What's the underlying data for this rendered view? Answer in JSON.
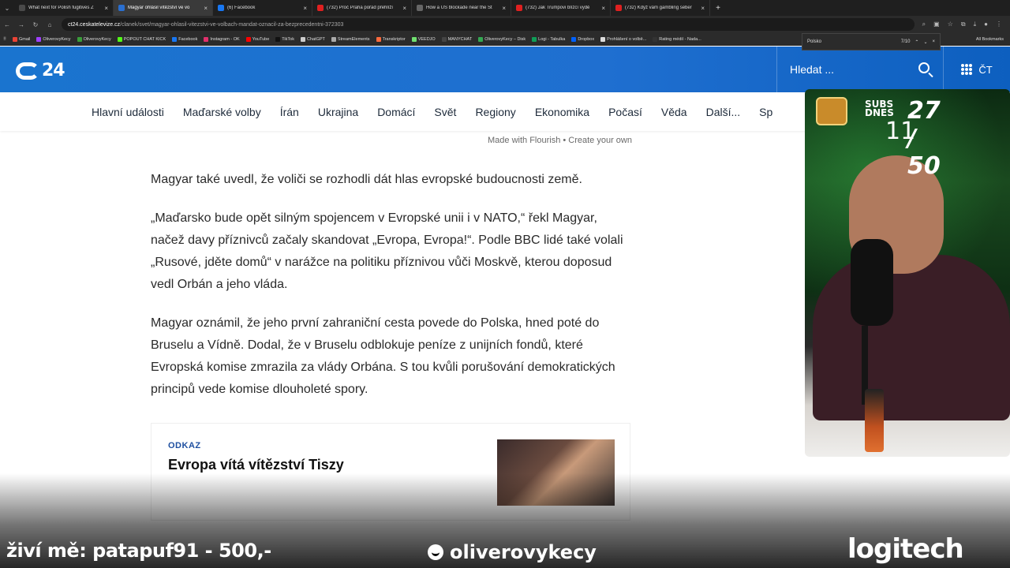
{
  "tabs": [
    {
      "label": "What next for Polish fugitives Z",
      "color": "#4a4a4a",
      "active": false
    },
    {
      "label": "Magyar ohlásil vítězství ve vo",
      "color": "#2a6fd0",
      "active": true
    },
    {
      "label": "(6) Facebook",
      "color": "#1877f2",
      "active": false
    },
    {
      "label": "(732) Proč Praha pořád přehlíží",
      "color": "#e02020",
      "active": false
    },
    {
      "label": "How a US blockade near the St",
      "color": "#666666",
      "active": false
    },
    {
      "label": "(732) Jak Trumpovi blízcí vydě",
      "color": "#e02020",
      "active": false
    },
    {
      "label": "(732) Když vám gambling seber",
      "color": "#e02020",
      "active": false
    }
  ],
  "address": {
    "domain": "ct24.ceskatelevize.cz",
    "path": "/clanek/svet/magyar-ohlasil-vitezstvi-ve-volbach-mandat-oznacil-za-bezprecedentni-372303"
  },
  "bookmarks": [
    {
      "label": "Gmail",
      "color": "#ea4335"
    },
    {
      "label": "OliverovyKecy",
      "color": "#a040ff"
    },
    {
      "label": "OliverovyKecy",
      "color": "#3a9d3a"
    },
    {
      "label": "POPOUT CHAT KICK",
      "color": "#53fc18"
    },
    {
      "label": "Facebook",
      "color": "#1877f2"
    },
    {
      "label": "Instagram - OK",
      "color": "#e1306c"
    },
    {
      "label": "YouTube",
      "color": "#ff0000"
    },
    {
      "label": "TikTok",
      "color": "#111111"
    },
    {
      "label": "ChatGPT",
      "color": "#cccccc"
    },
    {
      "label": "StreamElements",
      "color": "#aaaaaa"
    },
    {
      "label": "Transkriptor",
      "color": "#ff6a3d"
    },
    {
      "label": "VEEDJO",
      "color": "#70e070"
    },
    {
      "label": "MANYCHAT",
      "color": "#444444"
    },
    {
      "label": "OliverovyKecy – Disk",
      "color": "#34a853"
    },
    {
      "label": "Logi - Tabulka",
      "color": "#0f9d58"
    },
    {
      "label": "Dropbox",
      "color": "#0061ff"
    },
    {
      "label": "Prohlášení o volbě...",
      "color": "#dddddd"
    },
    {
      "label": "Rating médií - Nada...",
      "color": "#333333"
    }
  ],
  "all_bookmarks": "All Bookmarks",
  "find": {
    "query": "Polsko",
    "count": "7/10"
  },
  "site": {
    "logo_text": "24",
    "search_placeholder": "Hledat ...",
    "ct_label": "ČT"
  },
  "nav": [
    "Hlavní události",
    "Maďarské volby",
    "Írán",
    "Ukrajina",
    "Domácí",
    "Svět",
    "Regiony",
    "Ekonomika",
    "Počasí",
    "Věda",
    "Další...",
    "Sp"
  ],
  "flourish": "Made with Flourish • Create your own",
  "article": {
    "p1": "Magyar také uvedl, že voliči se rozhodli dát hlas evropské budoucnosti země.",
    "p2": "„Maďarsko bude opět silným spojencem v Evropské unii i v NATO,“ řekl Magyar, načež davy příznivců začaly skandovat „Evropa, Evropa!“. Podle BBC lidé také volali „Rusové, jděte domů“ v narážce na politiku příznivou vůči Moskvě, kterou doposud vedl Orbán a jeho vláda.",
    "p3": "Magyar oznámil, že jeho první zahraniční cesta povede do Polska, hned poté do Bruselu a Vídně. Dodal, že v Bruselu odblokuje peníze z unijních fondů, které Evropská komise zmrazila za vlády Orbána. S tou kvůli porušování demokratických principů vede komise dlouholeté spory."
  },
  "related": {
    "tag": "ODKAZ",
    "title": "Evropa vítá vítězství Tiszy"
  },
  "stream": {
    "subs_label": "SUBS DNES",
    "count": "27 / 50",
    "current": "11",
    "donor": "živí mě: patapuf91 - 500,-",
    "channel": "oliverovykecy",
    "sponsor": "logitech"
  }
}
